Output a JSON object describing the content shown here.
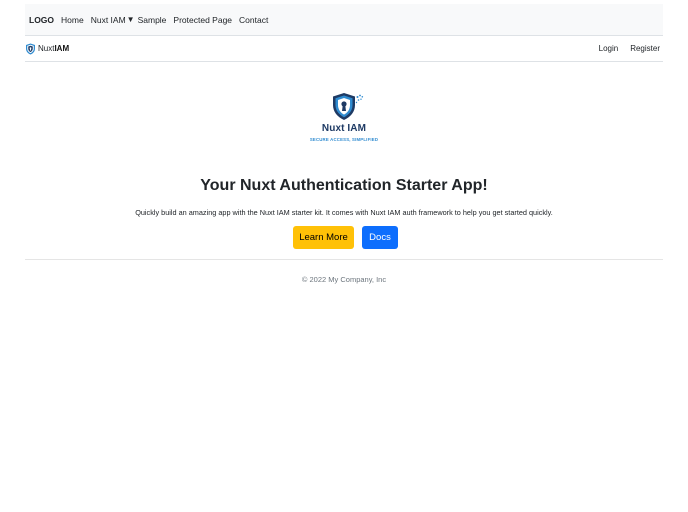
{
  "topnav": {
    "logo": "LOGO",
    "links": [
      "Home",
      "Nuxt IAM",
      "Sample",
      "Protected Page",
      "Contact"
    ],
    "dropdown_caret": "▼"
  },
  "appnav": {
    "brand_light": "Nuxt",
    "brand_bold": "IAM",
    "login": "Login",
    "register": "Register"
  },
  "hero": {
    "logo_name": "Nuxt IAM",
    "logo_tagline": "SECURE ACCESS, SIMPLIFIED",
    "title": "Your Nuxt Authentication Starter App!",
    "lead": "Quickly build an amazing app with the Nuxt IAM starter kit. It comes with Nuxt IAM auth framework to help you get started quickly.",
    "learn_more": "Learn More",
    "docs": "Docs"
  },
  "footer": {
    "copyright": "© 2022 My Company, Inc"
  },
  "colors": {
    "warning": "#ffc107",
    "primary": "#0d6efd",
    "shield_dark": "#1e3a64",
    "shield_light": "#2f8bd0"
  },
  "icons": [
    "shield-keyhole-icon"
  ]
}
